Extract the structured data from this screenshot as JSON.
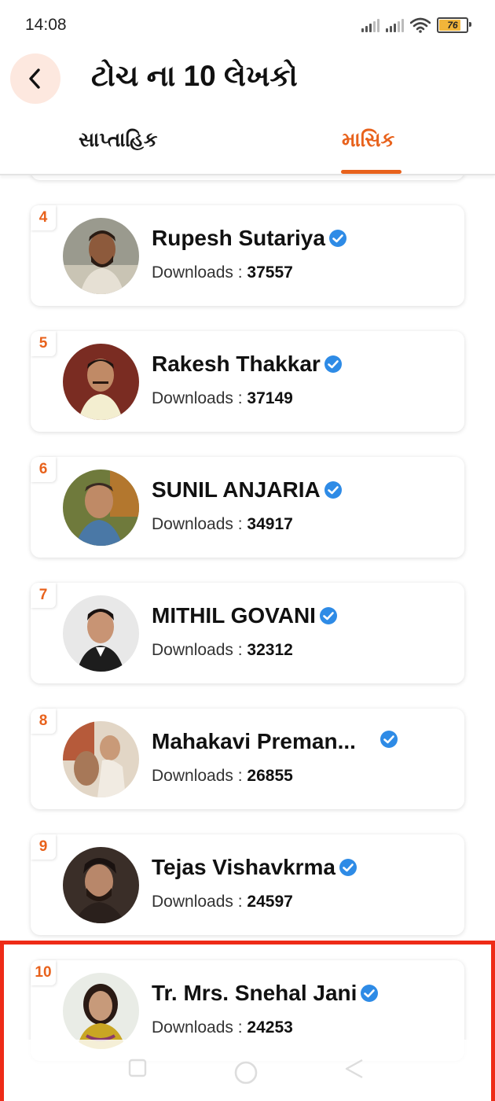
{
  "status_bar": {
    "time": "14:08",
    "battery_level": "76"
  },
  "header": {
    "title": "ટોચ ના 10 લેખકો",
    "back_icon": "chevron-left-icon"
  },
  "tabs": {
    "weekly": "સાપ્તાહિક",
    "monthly": "માસિક",
    "active": "monthly"
  },
  "colors": {
    "accent": "#e8621c",
    "highlight_border": "#ee2b17",
    "verified": "#2e8be6"
  },
  "authors": [
    {
      "rank": "4",
      "name": "Rupesh Sutariya",
      "downloads_label": "Downloads : ",
      "downloads": "37557"
    },
    {
      "rank": "5",
      "name": "Rakesh Thakkar",
      "downloads_label": "Downloads : ",
      "downloads": "37149"
    },
    {
      "rank": "6",
      "name": "SUNIL ANJARIA",
      "downloads_label": "Downloads : ",
      "downloads": "34917"
    },
    {
      "rank": "7",
      "name": "MITHIL GOVANI",
      "downloads_label": "Downloads : ",
      "downloads": "32312"
    },
    {
      "rank": "8",
      "name": "Mahakavi Preman...",
      "downloads_label": "Downloads : ",
      "downloads": "26855"
    },
    {
      "rank": "9",
      "name": "Tejas Vishavkrma",
      "downloads_label": "Downloads : ",
      "downloads": "24597"
    },
    {
      "rank": "10",
      "name": "Tr. Mrs. Snehal Jani",
      "downloads_label": "Downloads : ",
      "downloads": "24253"
    }
  ]
}
